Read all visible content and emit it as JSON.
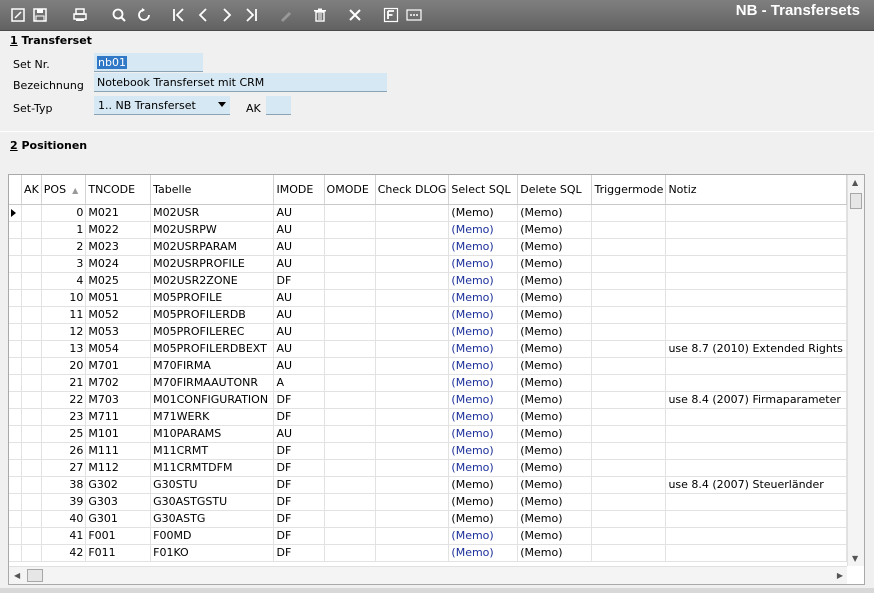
{
  "window_title": "NB - Transfersets",
  "toolbar": {
    "buttons": [
      {
        "name": "edit",
        "icon": "edit-icon"
      },
      {
        "name": "save",
        "icon": "save-icon"
      },
      {
        "name": "print",
        "icon": "print-icon"
      },
      {
        "name": "search",
        "icon": "search-icon"
      },
      {
        "name": "refresh",
        "icon": "refresh-icon"
      },
      {
        "name": "first",
        "icon": "first-record-icon"
      },
      {
        "name": "prev",
        "icon": "prev-record-icon"
      },
      {
        "name": "next",
        "icon": "next-record-icon"
      },
      {
        "name": "last",
        "icon": "last-record-icon"
      },
      {
        "name": "edit-disabled",
        "icon": "pencil-icon"
      },
      {
        "name": "delete",
        "icon": "trash-icon"
      },
      {
        "name": "close",
        "icon": "close-icon"
      },
      {
        "name": "filter",
        "icon": "filter-icon"
      },
      {
        "name": "more",
        "icon": "more-icon"
      }
    ]
  },
  "section1": {
    "number": "1",
    "title": " Transferset"
  },
  "form": {
    "set_nr_label": "Set Nr.",
    "set_nr_value": "nb01",
    "bezeichnung_label": "Bezeichnung",
    "bezeichnung_value": "Notebook Transferset mit CRM",
    "settyp_label": "Set-Typ",
    "settyp_value": "1.. NB Transferset",
    "ak_label": "AK",
    "ak_value": ""
  },
  "section2": {
    "number": "2",
    "title": " Positionen"
  },
  "grid": {
    "columns": [
      "AK",
      "POS",
      "TNCODE",
      "Tabelle",
      "IMODE",
      "OMODE",
      "Check DLOG",
      "Select SQL",
      "Delete SQL",
      "Triggermode",
      "Notiz"
    ],
    "rows": [
      {
        "pos": "0",
        "tncode": "M021",
        "tabelle": "M02USR",
        "imode": "AU",
        "select": "(Memo)",
        "delete": "(Memo)",
        "notiz": "",
        "blue": false
      },
      {
        "pos": "1",
        "tncode": "M022",
        "tabelle": "M02USRPW",
        "imode": "AU",
        "select": "(Memo)",
        "delete": "(Memo)",
        "notiz": "",
        "blue": true
      },
      {
        "pos": "2",
        "tncode": "M023",
        "tabelle": "M02USRPARAM",
        "imode": "AU",
        "select": "(Memo)",
        "delete": "(Memo)",
        "notiz": "",
        "blue": true
      },
      {
        "pos": "3",
        "tncode": "M024",
        "tabelle": "M02USRPROFILE",
        "imode": "AU",
        "select": "(Memo)",
        "delete": "(Memo)",
        "notiz": "",
        "blue": true
      },
      {
        "pos": "4",
        "tncode": "M025",
        "tabelle": "M02USR2ZONE",
        "imode": "DF",
        "select": "(Memo)",
        "delete": "(Memo)",
        "notiz": "",
        "blue": true
      },
      {
        "pos": "10",
        "tncode": "M051",
        "tabelle": "M05PROFILE",
        "imode": "AU",
        "select": "(Memo)",
        "delete": "(Memo)",
        "notiz": "",
        "blue": true
      },
      {
        "pos": "11",
        "tncode": "M052",
        "tabelle": "M05PROFILERDB",
        "imode": "AU",
        "select": "(Memo)",
        "delete": "(Memo)",
        "notiz": "",
        "blue": true
      },
      {
        "pos": "12",
        "tncode": "M053",
        "tabelle": "M05PROFILEREC",
        "imode": "AU",
        "select": "(Memo)",
        "delete": "(Memo)",
        "notiz": "",
        "blue": true
      },
      {
        "pos": "13",
        "tncode": "M054",
        "tabelle": "M05PROFILERDBEXT",
        "imode": "AU",
        "select": "(Memo)",
        "delete": "(Memo)",
        "notiz": "use 8.7 (2010) Extended Rights",
        "blue": true
      },
      {
        "pos": "20",
        "tncode": "M701",
        "tabelle": "M70FIRMA",
        "imode": "AU",
        "select": "(Memo)",
        "delete": "(Memo)",
        "notiz": "",
        "blue": true
      },
      {
        "pos": "21",
        "tncode": "M702",
        "tabelle": "M70FIRMAAUTONR",
        "imode": "A",
        "select": "(Memo)",
        "delete": "(Memo)",
        "notiz": "",
        "blue": true
      },
      {
        "pos": "22",
        "tncode": "M703",
        "tabelle": "M01CONFIGURATION",
        "imode": "DF",
        "select": "(Memo)",
        "delete": "(Memo)",
        "notiz": "use 8.4 (2007) Firmaparameter",
        "blue": true
      },
      {
        "pos": "23",
        "tncode": "M711",
        "tabelle": "M71WERK",
        "imode": "DF",
        "select": "(Memo)",
        "delete": "(Memo)",
        "notiz": "",
        "blue": true
      },
      {
        "pos": "25",
        "tncode": "M101",
        "tabelle": "M10PARAMS",
        "imode": "AU",
        "select": "(Memo)",
        "delete": "(Memo)",
        "notiz": "",
        "blue": true
      },
      {
        "pos": "26",
        "tncode": "M111",
        "tabelle": "M11CRMT",
        "imode": "DF",
        "select": "(Memo)",
        "delete": "(Memo)",
        "notiz": "",
        "blue": true
      },
      {
        "pos": "27",
        "tncode": "M112",
        "tabelle": "M11CRMTDFM",
        "imode": "DF",
        "select": "(Memo)",
        "delete": "(Memo)",
        "notiz": "",
        "blue": true
      },
      {
        "pos": "38",
        "tncode": "G302",
        "tabelle": "G30STU",
        "imode": "DF",
        "select": "(Memo)",
        "delete": "(Memo)",
        "notiz": "use 8.4 (2007) Steuerländer",
        "blue": false
      },
      {
        "pos": "39",
        "tncode": "G303",
        "tabelle": "G30ASTGSTU",
        "imode": "DF",
        "select": "(Memo)",
        "delete": "(Memo)",
        "notiz": "",
        "blue": false
      },
      {
        "pos": "40",
        "tncode": "G301",
        "tabelle": "G30ASTG",
        "imode": "DF",
        "select": "(Memo)",
        "delete": "(Memo)",
        "notiz": "",
        "blue": false
      },
      {
        "pos": "41",
        "tncode": "F001",
        "tabelle": "F00MD",
        "imode": "DF",
        "select": "(Memo)",
        "delete": "(Memo)",
        "notiz": "",
        "blue": true
      },
      {
        "pos": "42",
        "tncode": "F011",
        "tabelle": "F01KO",
        "imode": "DF",
        "select": "(Memo)",
        "delete": "(Memo)",
        "notiz": "",
        "blue": true
      }
    ]
  },
  "colors": {
    "toolbar": "#6e6e6e",
    "field_bg": "#d6e8f3",
    "memo_blue": "#1b2f9a",
    "selection": "#3178c6"
  }
}
